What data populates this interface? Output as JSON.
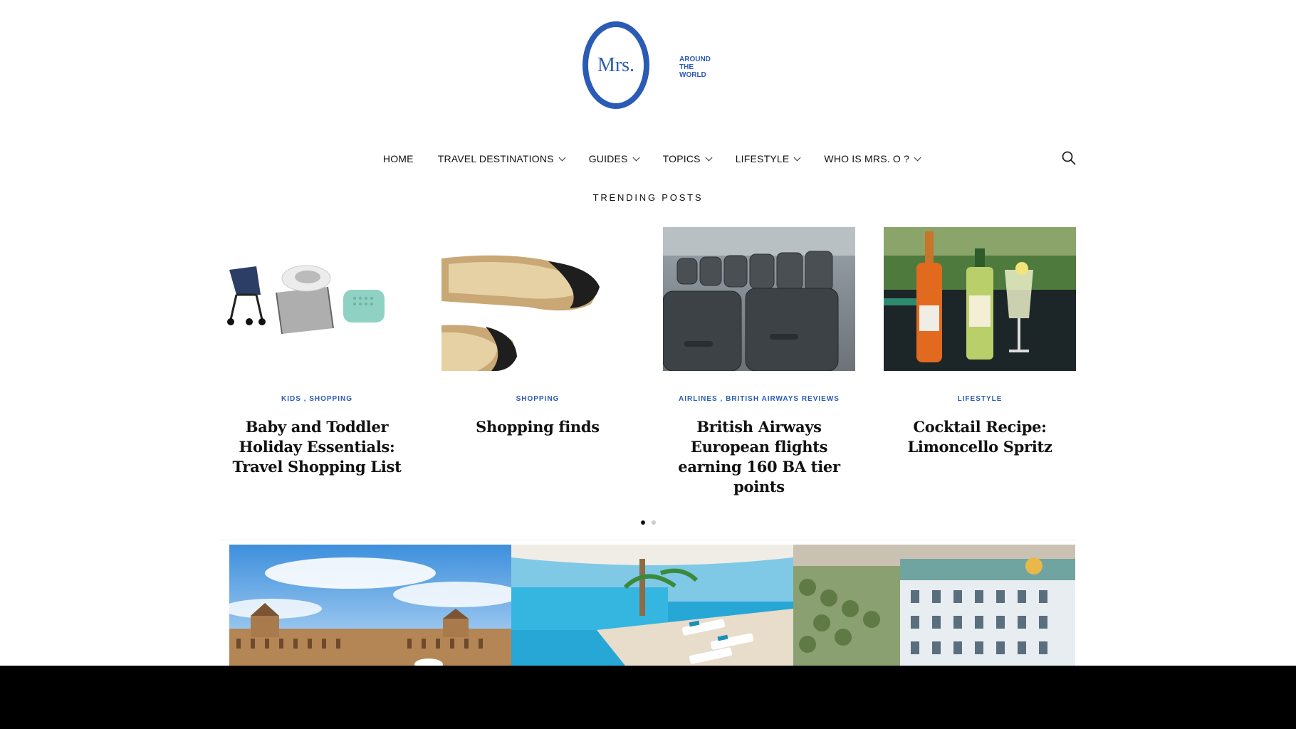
{
  "logo": {
    "mark": "Mrs.",
    "tagline": [
      "AROUND",
      "THE",
      "WORLD"
    ]
  },
  "nav": {
    "items": [
      {
        "label": "HOME",
        "dropdown": false
      },
      {
        "label": "TRAVEL DESTINATIONS",
        "dropdown": true
      },
      {
        "label": "GUIDES",
        "dropdown": true
      },
      {
        "label": "TOPICS",
        "dropdown": true
      },
      {
        "label": "LIFESTYLE",
        "dropdown": true
      },
      {
        "label": "WHO IS MRS. O ?",
        "dropdown": true
      }
    ],
    "search_icon": "search-icon"
  },
  "trending": {
    "heading": "TRENDING POSTS"
  },
  "cards": [
    {
      "categories": [
        "KIDS",
        "SHOPPING"
      ],
      "title": "Baby and Toddler Holiday Essentials: Travel Shopping List"
    },
    {
      "categories": [
        "SHOPPING"
      ],
      "title": "Shopping finds"
    },
    {
      "categories": [
        "AIRLINES",
        "BRITISH AIRWAYS REVIEWS"
      ],
      "title": "British Airways European flights earning 160 BA tier points"
    },
    {
      "categories": [
        "LIFESTYLE"
      ],
      "title": "Cocktail Recipe: Limoncello Spritz"
    }
  ],
  "carousel": {
    "pages": 2,
    "active_page": 1
  },
  "feature_images": [
    "plaza-de-espana",
    "beach-resort-pool",
    "atlantic-hotel"
  ],
  "colors": {
    "brand": "#2a5bb5",
    "text": "#111111"
  }
}
